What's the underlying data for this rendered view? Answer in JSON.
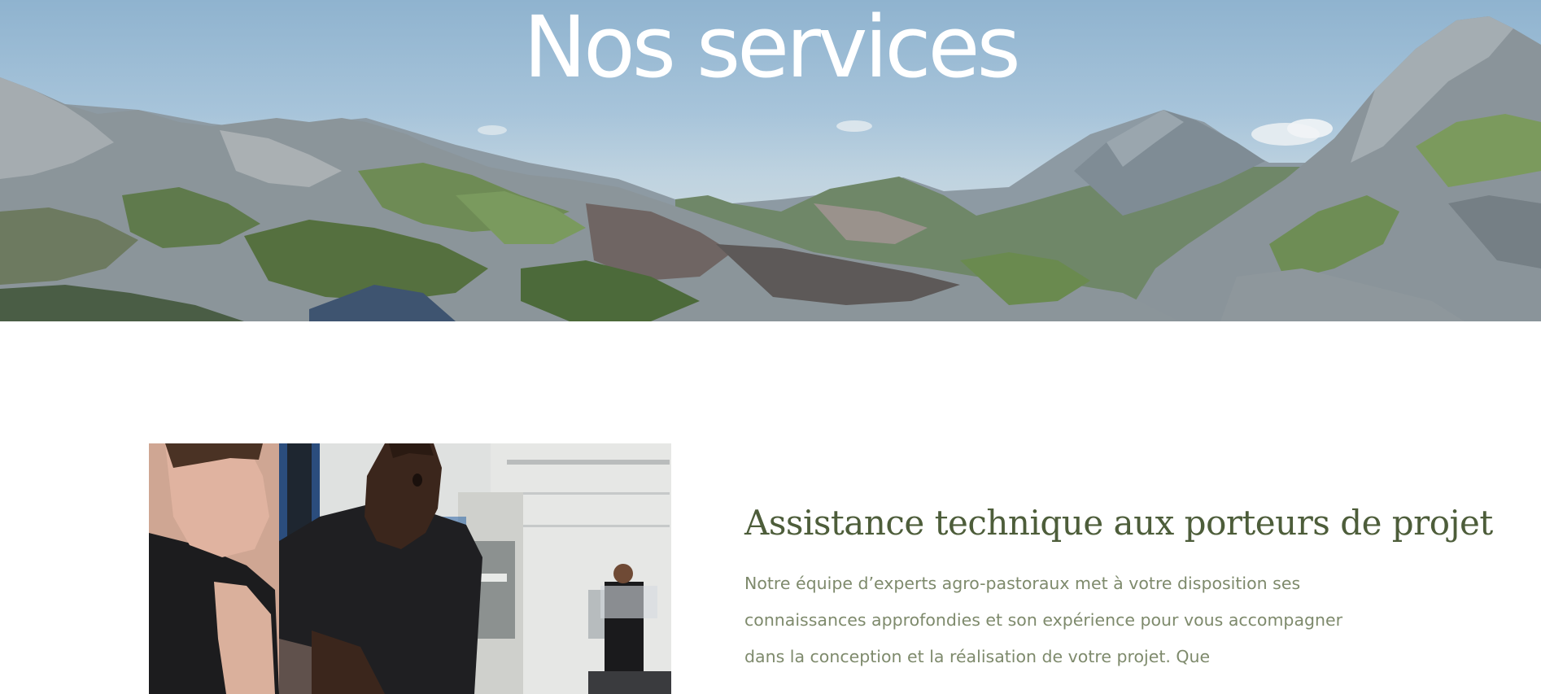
{
  "hero": {
    "title": "Nos services",
    "background": "mountain-landscape-photo"
  },
  "service": {
    "image": "technicians-workshop-photo",
    "title": "Assistance technique aux porteurs de projet",
    "description": "Notre équipe d’experts agro-pastoraux met à votre disposition ses connaissances approfondies et son expérience pour vous accompagner dans la conception et la réalisation de votre projet. Que"
  },
  "colors": {
    "title_green": "#4d5d3a",
    "text_green": "#7e8a6c",
    "hero_text": "#ffffff"
  }
}
